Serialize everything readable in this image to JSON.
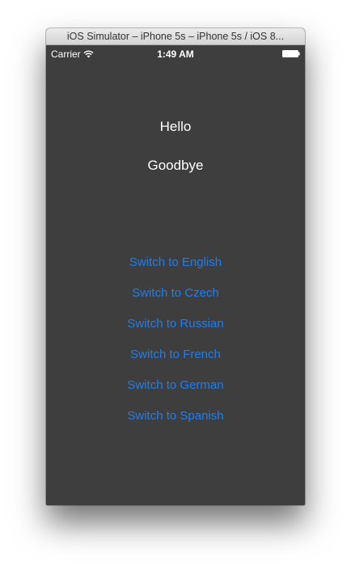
{
  "window": {
    "title": "iOS Simulator – iPhone 5s – iPhone 5s / iOS 8..."
  },
  "status_bar": {
    "carrier": "Carrier",
    "time": "1:49 AM",
    "icons": [
      "wifi-icon",
      "battery-icon"
    ]
  },
  "content": {
    "hello": "Hello",
    "goodbye": "Goodbye"
  },
  "buttons": [
    "Switch to English",
    "Switch to Czech",
    "Switch to Russian",
    "Switch to French",
    "Switch to German",
    "Switch to Spanish"
  ],
  "colors": {
    "background": "#3e3e3e",
    "button_text": "#1a7ff5",
    "label_text": "#ffffff"
  }
}
